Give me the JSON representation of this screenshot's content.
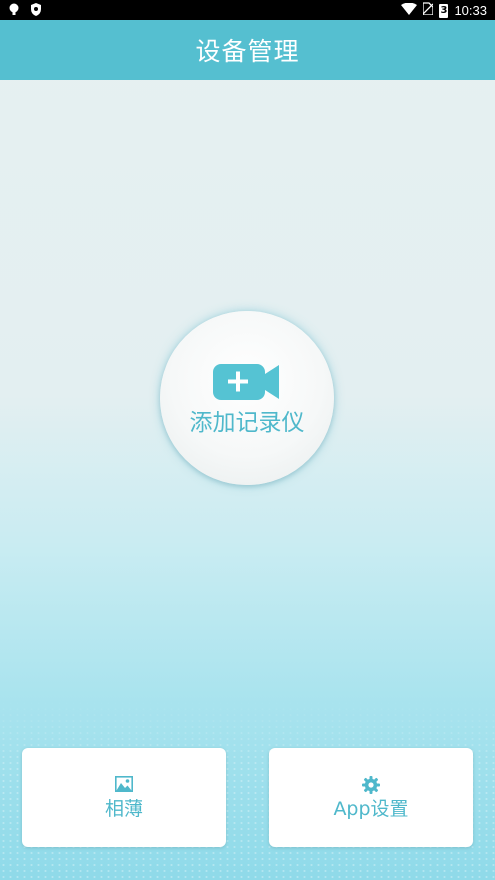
{
  "status_bar": {
    "time": "10:33",
    "battery_level": "3"
  },
  "title_bar": {
    "title": "设备管理"
  },
  "main": {
    "add_recorder_label": "添加记录仪"
  },
  "bottom_nav": {
    "album_label": "相薄",
    "settings_label": "App设置"
  },
  "colors": {
    "accent": "#55bfd0",
    "accent_text": "#4fb8cb"
  },
  "icons": {
    "add_recorder": "video-camera-plus-icon",
    "album": "image-icon",
    "settings": "gear-icon"
  }
}
